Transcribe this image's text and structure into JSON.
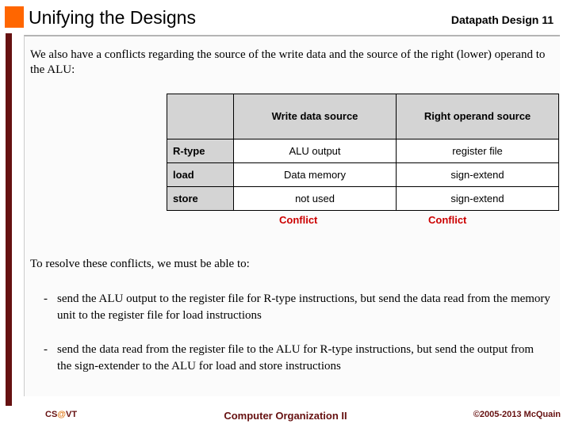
{
  "header": {
    "title": "Unifying the Designs",
    "right_label": "Datapath Design  11",
    "accent_color": "#FF6600"
  },
  "body": {
    "intro_paragraph": "We also have a conflicts regarding the source of the write data and the source of the right (lower) operand to the ALU:",
    "resolve_paragraph": "To resolve these conflicts, we must be able to:",
    "bullets": [
      {
        "marker": "-",
        "text": "send the ALU output to the register file for R-type instructions, but send the data read from the memory unit to the register file for load instructions"
      },
      {
        "marker": "-",
        "text": "send the data read from the register file to the ALU for R-type instructions, but send the output from the sign-extender to the ALU for load and store instructions"
      }
    ]
  },
  "table": {
    "corner_header": "",
    "columns": [
      "Write data source",
      "Right operand source"
    ],
    "rows": [
      {
        "label": "R-type",
        "cells": [
          "ALU output",
          "register file"
        ]
      },
      {
        "label": "load",
        "cells": [
          "Data memory",
          "sign-extend"
        ]
      },
      {
        "label": "store",
        "cells": [
          "not used",
          "sign-extend"
        ]
      }
    ],
    "header_bg": "#d4d4d4",
    "cell_bg": "#ffffff",
    "border_color": "#000000"
  },
  "annotations": {
    "conflict_1": "Conflict",
    "conflict_2": "Conflict",
    "conflict_color": "#CC0000"
  },
  "footer": {
    "left_prefix": "CS",
    "left_at": "@",
    "left_suffix": "VT",
    "center": "Computer Organization II",
    "right": "©2005-2013 McQuain",
    "text_color": "#661111",
    "at_color": "#E07B1A"
  }
}
